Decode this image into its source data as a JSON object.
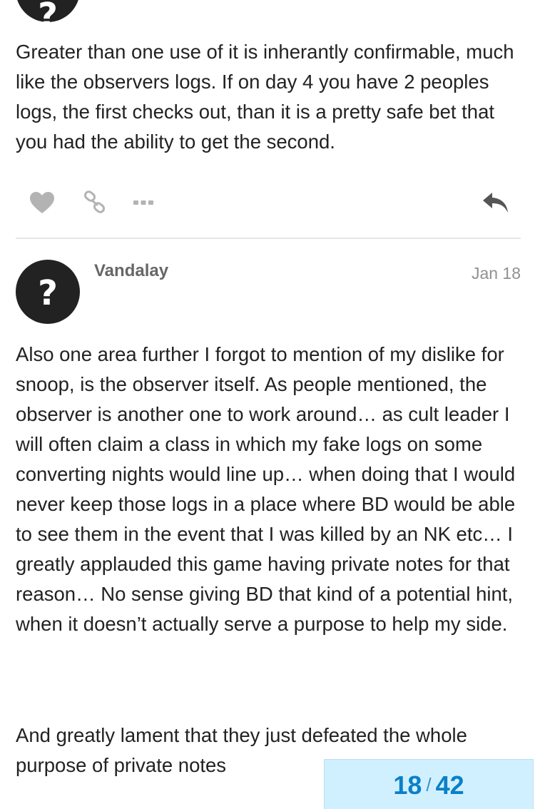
{
  "previous_post": {
    "avatar_glyph": "?",
    "body": "Greater than one use of it is inherantly confirmable, much like the observers logs. If on day 4 you have 2 peoples logs, the first checks out, than it is a pretty safe bet that you had the ability to get the second.",
    "actions": {
      "like_icon": "heart-icon",
      "link_icon": "link-icon",
      "more_icon": "more-icon",
      "reply_icon": "reply-icon"
    }
  },
  "post": {
    "avatar_glyph": "?",
    "username": "Vandalay",
    "date": "Jan 18",
    "paragraphs": [
      "Also one area further I forgot to mention of my dislike for snoop, is the observer itself. As people mentioned, the observer is another one to work around… as cult leader I will often claim a class in which my fake logs on some converting nights would line up… when doing that I would never keep those logs in a place where BD would be able to see them in the event that I was killed by an NK etc… I greatly applauded this game having private notes for that reason… No sense giving BD that kind of a potential hint, when it doesn’t actually serve a purpose to help my side.",
      "And greatly lament that they just defeated the whole purpose of private notes"
    ]
  },
  "progress": {
    "current": "18",
    "separator": "/",
    "total": "42"
  },
  "colors": {
    "avatar_bg": "#222222",
    "icon_gray": "#b3b3b3",
    "username": "#666666",
    "date": "#919191",
    "progress_bg": "#d1f0ff",
    "progress_text": "#0a80c8"
  }
}
